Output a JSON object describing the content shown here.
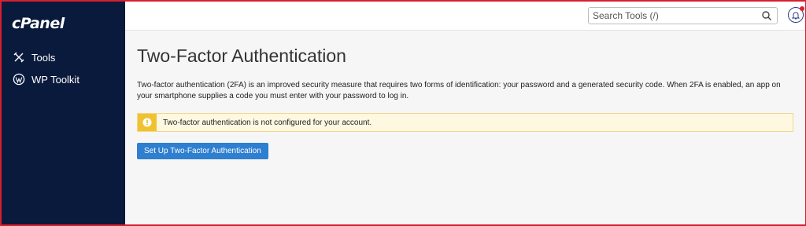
{
  "brand": {
    "logo_text": "cPanel"
  },
  "sidebar": {
    "items": [
      {
        "label": "Tools",
        "icon": "tools-icon"
      },
      {
        "label": "WP Toolkit",
        "icon": "wordpress-icon"
      }
    ]
  },
  "header": {
    "search": {
      "placeholder": "Search Tools (/)",
      "value": ""
    },
    "notifications": {
      "icon": "bell-icon",
      "has_unread": true
    }
  },
  "main": {
    "title": "Two-Factor Authentication",
    "description": "Two-factor authentication (2FA) is an improved security measure that requires two forms of identification: your password and a generated security code. When 2FA is enabled, an app on your smartphone supplies a code you must enter with your password to log in.",
    "alert": {
      "icon": "warning-icon",
      "message": "Two-factor authentication is not configured for your account."
    },
    "setup_button": "Set Up Two-Factor Authentication"
  },
  "colors": {
    "sidebar_bg": "#0a1a3c",
    "button_blue": "#2f7fd0",
    "alert_bg": "#fff8e1",
    "alert_badge": "#f0c232",
    "frame_border": "#d8202e"
  }
}
